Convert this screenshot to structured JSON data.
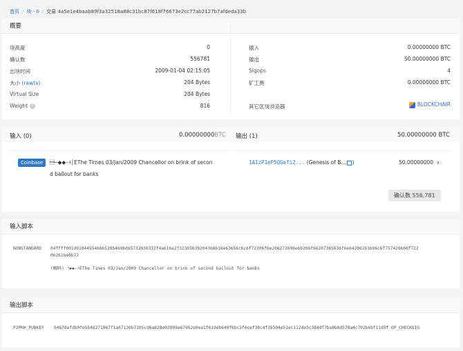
{
  "breadcrumb": {
    "home": "首页",
    "block": "块 - 0",
    "current": "交易 4a5e1e4baab89f3a32518a88c31bc87f618f76673e2cc77ab2127b7afdeda33b"
  },
  "summary": {
    "title": "概要",
    "left": [
      {
        "label": "块高度",
        "value": "0"
      },
      {
        "label": "确认数",
        "value": "556781"
      },
      {
        "label": "出块时间",
        "value": "2009-01-04 02:15:05"
      },
      {
        "label": "大小",
        "link": "(rawtx)",
        "value": "204 Bytes"
      },
      {
        "label": "Virtual Size",
        "value": "204 Bytes"
      },
      {
        "label": "Weight",
        "value": "816"
      }
    ],
    "right": [
      {
        "label": "输入",
        "value": "0.00000000 BTC"
      },
      {
        "label": "输出",
        "value": "50.00000000 BTC"
      },
      {
        "label": "Sigops",
        "value": "4"
      },
      {
        "label": "矿工费",
        "value": "0.00000000 BTC"
      }
    ],
    "explorer_label": "其它区块浏览器",
    "explorer_name": "BLOCKCHAIR"
  },
  "io": {
    "inputs_title": "输入 (0)",
    "inputs_amount": "0.00000000",
    "inputs_unit": "BTC",
    "outputs_title": "输出 (1)",
    "outputs_amount": "50.00000000 BTC",
    "coinbase_badge": "Coinbase",
    "coinbase_text_1": "\u0001─◆◆–˧│EThe Times 03/Jan/2009 Chancellor on brink of secon",
    "coinbase_text_2": "d bailout for banks",
    "output_address": "1A1zP1eP5QGefi2...",
    "output_label": "(Genesis of B...",
    "output_label_end": ")",
    "output_amount": "50.00000000",
    "confirmations": "确认数 556,781"
  },
  "input_script": {
    "title": "输入脚本",
    "type": "NONSTANDARD",
    "hex_1": "04ffff001d0104455468652054696d65732030332f4a616e2f32303039204368616e63656c6c6f72206f6e206272696e6b206f66207365636f6e64206261696c6f757420666f722",
    "hex_2": "062616e6b73",
    "decoded": "(解码) ˥◆◆–˧EThe Times 03/Jan/2009 Chancellor on brink of second bailout for banks"
  },
  "output_script": {
    "title": "输出脚本",
    "type": "P2PKH_PUBKEY",
    "hex": "04678afdb0fe5548271967f1a67130b7105cd6a828e03909a67962e0ea1f61deb649f6bc3f4cef38c4f35504e51ec112de5c384df7ba0b8d578a4c702b6bf11d5f OP_CHECKSIG"
  },
  "colors": {
    "accent": "#2b7bd4",
    "badge": "#3279c8"
  }
}
